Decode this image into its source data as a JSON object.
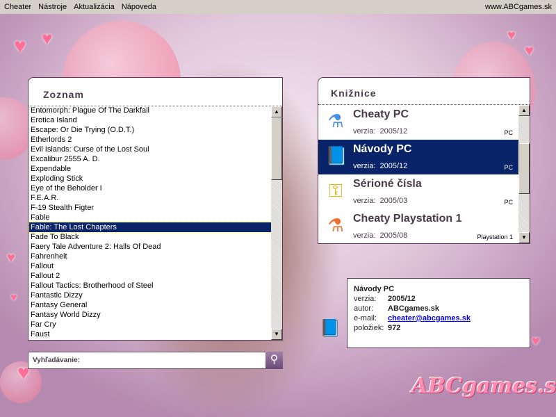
{
  "menu": {
    "items": [
      "Cheater",
      "Nástroje",
      "Aktualizácia",
      "Nápoveda"
    ],
    "site": "www.ABCgames.sk"
  },
  "zoznam": {
    "title": "Zoznam",
    "selected_index": 12,
    "items": [
      "Entomorph: Plague Of The Darkfall",
      "Erotica Island",
      "Escape: Or Die Trying (O.D.T.)",
      "Etherlords 2",
      "Evil Islands: Curse of the Lost Soul",
      "Excalibur 2555 A. D.",
      "Expendable",
      "Exploding Stick",
      "Eye of the Beholder I",
      "F.E.A.R.",
      "F-19 Stealth Figter",
      "Fable",
      "Fable: The Lost Chapters",
      "Fade To Black",
      "Faery Tale Adventure 2: Halls Of Dead",
      "Fahrenheit",
      "Fallout",
      "Fallout 2",
      "Fallout Tactics: Brotherhood of Steel",
      "Fantastic Dizzy",
      "Fantasy General",
      "Fantasy World Dizzy",
      "Far Cry",
      "Faust"
    ]
  },
  "search": {
    "label": "Vyhľadávanie:",
    "value": ""
  },
  "kniznice": {
    "title": "Knižnice",
    "items": [
      {
        "name": "Cheaty PC",
        "version_label": "verzia:",
        "version": "2005/12",
        "platform": "PC",
        "icon": "flask-blue-icon"
      },
      {
        "name": "Návody PC",
        "version_label": "verzia:",
        "version": "2005/12",
        "platform": "PC",
        "icon": "book-icon",
        "selected": true
      },
      {
        "name": "Sérioné čísla",
        "version_label": "verzia:",
        "version": "2005/03",
        "platform": "PC",
        "icon": "key-icon"
      },
      {
        "name": "Cheaty Playstation 1",
        "version_label": "verzia:",
        "version": "2005/08",
        "platform": "Playstation 1",
        "icon": "flask-orange-icon"
      }
    ]
  },
  "info": {
    "title": "Návody PC",
    "rows": [
      {
        "label": "verzia:",
        "value": "2005/12"
      },
      {
        "label": "autor:",
        "value": "ABCgames.sk"
      },
      {
        "label": "e-mail:",
        "value": "cheater@abcgames.sk"
      },
      {
        "label": "položiek:",
        "value": "972"
      }
    ]
  },
  "logo": "ABCgames.sk",
  "colors": {
    "selection": "#0a246a",
    "link": "#0000ee",
    "logo": "#ff7aa0"
  }
}
